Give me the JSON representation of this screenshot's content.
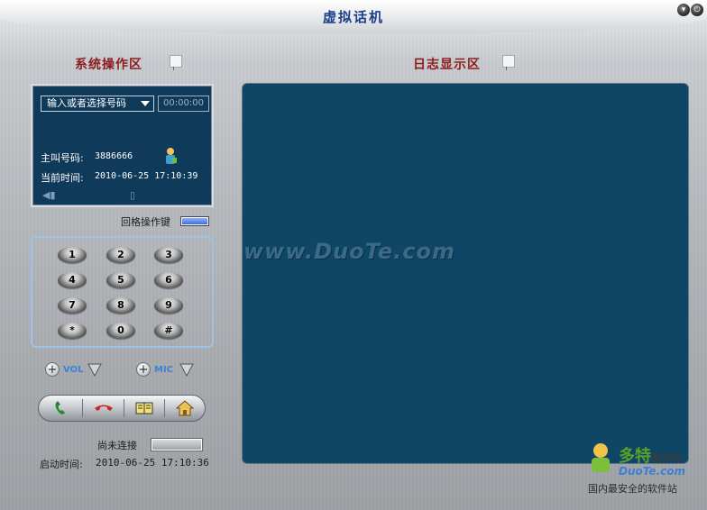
{
  "window": {
    "title": "虚拟话机",
    "minimize_glyph": "▾",
    "close_glyph": "⏻"
  },
  "left": {
    "section_title": "系统操作区",
    "number_select": {
      "value": "输入或者选择号码"
    },
    "timer": "00:00:00",
    "caller_label": "主叫号码:",
    "caller_value": "3886666",
    "time_label": "当前时间:",
    "time_value": "2010-06-25  17:10:39",
    "back_button_label": "回格操作键",
    "keypad": [
      "1",
      "2",
      "3",
      "4",
      "5",
      "6",
      "7",
      "8",
      "9",
      "*",
      "0",
      "#"
    ],
    "vol": {
      "plus": "+",
      "label": "VOL"
    },
    "mic": {
      "plus": "+",
      "label": "MIC"
    },
    "status_label": "尚未连接",
    "start_label": "启动时间:",
    "start_value": "2010-06-25  17:10:36"
  },
  "right": {
    "section_title": "日志显示区",
    "watermark": "www.DuoTe.com"
  },
  "brand": {
    "name": "多特",
    "suffix": "软件站",
    "url": "DuoTe.com",
    "slogan": "国内最安全的软件站"
  },
  "colors": {
    "panel_bg": "#0f3a5a",
    "log_bg": "#0f4666",
    "title_blue": "#1b3f8a",
    "section_red": "#8c1c1c",
    "accent_blue": "#3b82d6"
  }
}
